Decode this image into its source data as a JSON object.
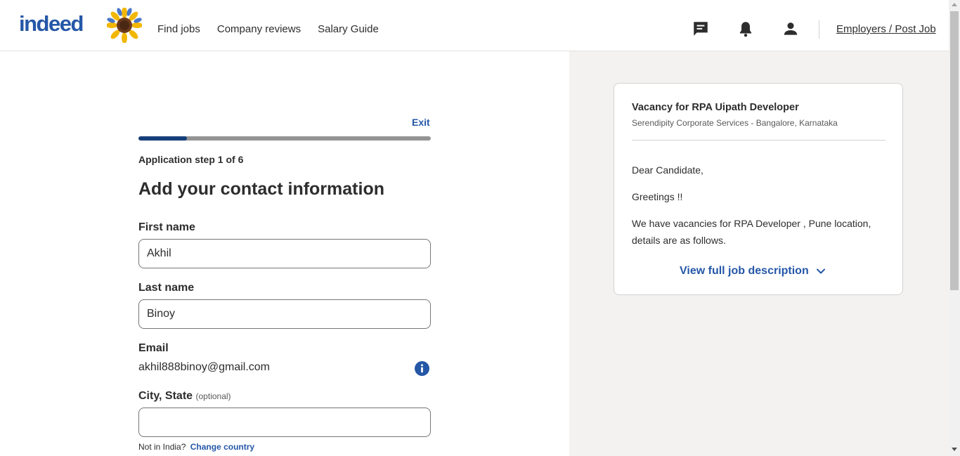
{
  "header": {
    "logo_text": "indeed",
    "nav": {
      "find_jobs": "Find jobs",
      "company_reviews": "Company reviews",
      "salary_guide": "Salary Guide"
    },
    "employers_label": "Employers / Post Job"
  },
  "form": {
    "exit_label": "Exit",
    "progress": {
      "current_step": 1,
      "total_steps": 6,
      "fraction": 0.167
    },
    "step_label": "Application step 1 of 6",
    "heading": "Add your contact information",
    "first_name": {
      "label": "First name",
      "value": "Akhil"
    },
    "last_name": {
      "label": "Last name",
      "value": "Binoy"
    },
    "email": {
      "label": "Email",
      "value": "akhil888binoy@gmail.com"
    },
    "city_state": {
      "label": "City, State",
      "optional_text": "(optional)",
      "value": ""
    },
    "not_in_country_text": "Not in India?",
    "change_country_label": "Change country"
  },
  "job_card": {
    "title": "Vacancy for RPA Uipath Developer",
    "company_location": "Serendipity Corporate Services - Bangalore, Karnataka",
    "greeting": "Dear Candidate,",
    "greetings_line": "Greetings !!",
    "description": "We have vacancies for RPA Developer , Pune location, details are as follows.",
    "view_full_label": "View full job description"
  },
  "colors": {
    "brand_blue": "#2557a7",
    "progress_fill": "#163f7a",
    "right_panel_bg": "#f3f2f1"
  },
  "icons": [
    "sunflower-icon",
    "message-icon",
    "bell-icon",
    "profile-icon",
    "info-icon",
    "chevron-down-icon"
  ]
}
